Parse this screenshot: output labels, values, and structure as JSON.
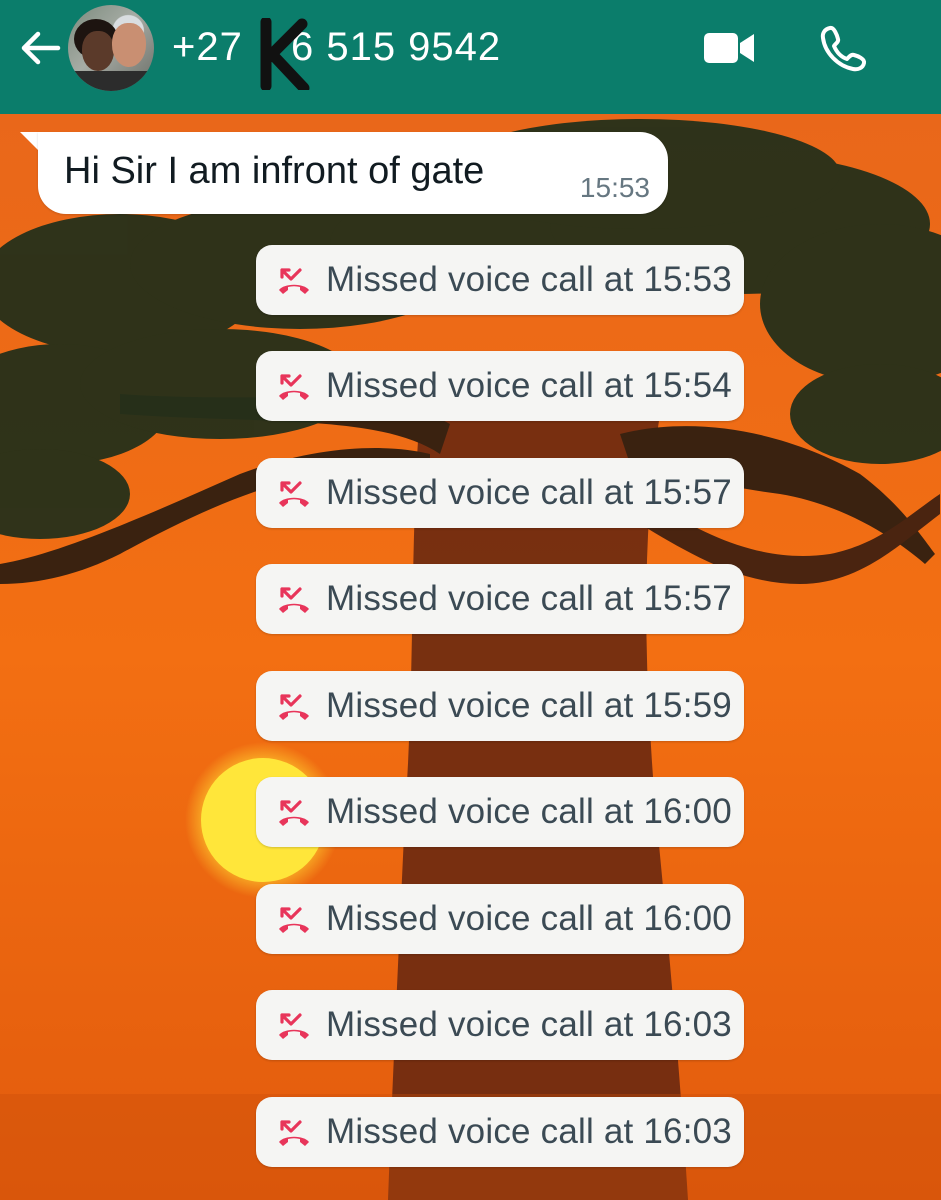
{
  "header": {
    "contact_name": "+27 ",
    "contact_name_rest": "6 515 9542",
    "back_icon": "arrow-left-icon",
    "video_icon": "video-camera-icon",
    "call_icon": "phone-icon",
    "background_color": "#0b7d6b"
  },
  "chat": {
    "incoming_message": {
      "text": "Hi Sir I am infront of gate",
      "time": "15:53"
    },
    "missed_calls": [
      {
        "label": "Missed voice call at 15:53"
      },
      {
        "label": "Missed voice call at 15:54"
      },
      {
        "label": "Missed voice call at 15:57"
      },
      {
        "label": "Missed voice call at 15:57"
      },
      {
        "label": "Missed voice call at 15:59"
      },
      {
        "label": "Missed voice call at 16:00"
      },
      {
        "label": "Missed voice call at 16:00"
      },
      {
        "label": "Missed voice call at 16:03"
      },
      {
        "label": "Missed voice call at 16:03"
      }
    ],
    "missed_call_icon": "missed-call-icon",
    "missed_call_icon_color": "#e8355a"
  },
  "wallpaper": {
    "description_icon": "baobab-sunset-wallpaper",
    "sky_color": "#f06a10",
    "sun_color": "#ffe63a"
  }
}
